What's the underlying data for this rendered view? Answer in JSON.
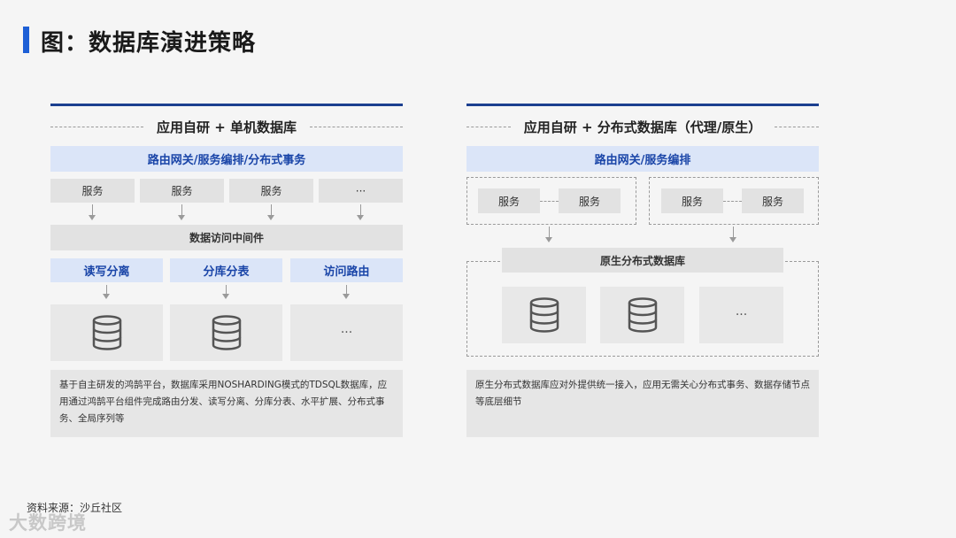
{
  "title": "图：数据库演进策略",
  "left": {
    "heading": "应用自研 + 单机数据库",
    "gateway": "路由网关/服务编排/分布式事务",
    "services": [
      "服务",
      "服务",
      "服务",
      "···"
    ],
    "middleware": "数据访问中间件",
    "functions": [
      "读写分离",
      "分库分表",
      "访问路由"
    ],
    "db_more": "···",
    "description": "基于自主研发的鸿鹄平台，数据库采用NOSHARDING模式的TDSQL数据库，应用通过鸿鹄平台组件完成路由分发、读写分离、分库分表、水平扩展、分布式事务、全局序列等"
  },
  "right": {
    "heading": "应用自研 + 分布式数据库（代理/原生）",
    "gateway": "路由网关/服务编排",
    "group1": [
      "服务",
      "服务"
    ],
    "group2": [
      "服务",
      "服务"
    ],
    "db_title": "原生分布式数据库",
    "db_more": "···",
    "description": "原生分布式数据库应对外提供统一接入，应用无需关心分布式事务、数据存储节点等底层细节"
  },
  "source": "资料来源：沙丘社区",
  "watermark": "大数跨境",
  "colors": {
    "accent": "#1d5fd6",
    "rule": "#1b3f8f",
    "blue_bar": "#dbe5f8",
    "blue_text": "#1a45a8"
  }
}
